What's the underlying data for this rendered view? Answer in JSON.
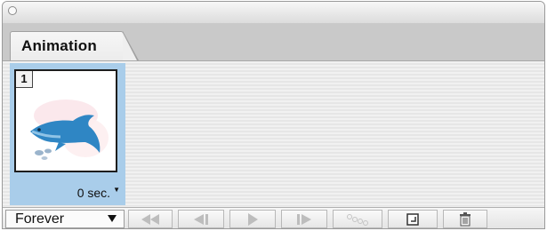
{
  "panel": {
    "tab_label": "Animation"
  },
  "frames": [
    {
      "number": "1",
      "delay": "0 sec.",
      "thumbnail": "dolphin-image"
    }
  ],
  "toolbar": {
    "loop_option": "Forever",
    "buttons": [
      {
        "icon": "first-frame-icon"
      },
      {
        "icon": "previous-frame-icon"
      },
      {
        "icon": "play-icon"
      },
      {
        "icon": "next-frame-icon"
      },
      {
        "icon": "tween-icon"
      },
      {
        "icon": "duplicate-frame-icon"
      },
      {
        "icon": "trash-icon"
      }
    ]
  },
  "colors": {
    "selected_frame": "#a9cdea",
    "dolphin": "#2f86c4"
  }
}
